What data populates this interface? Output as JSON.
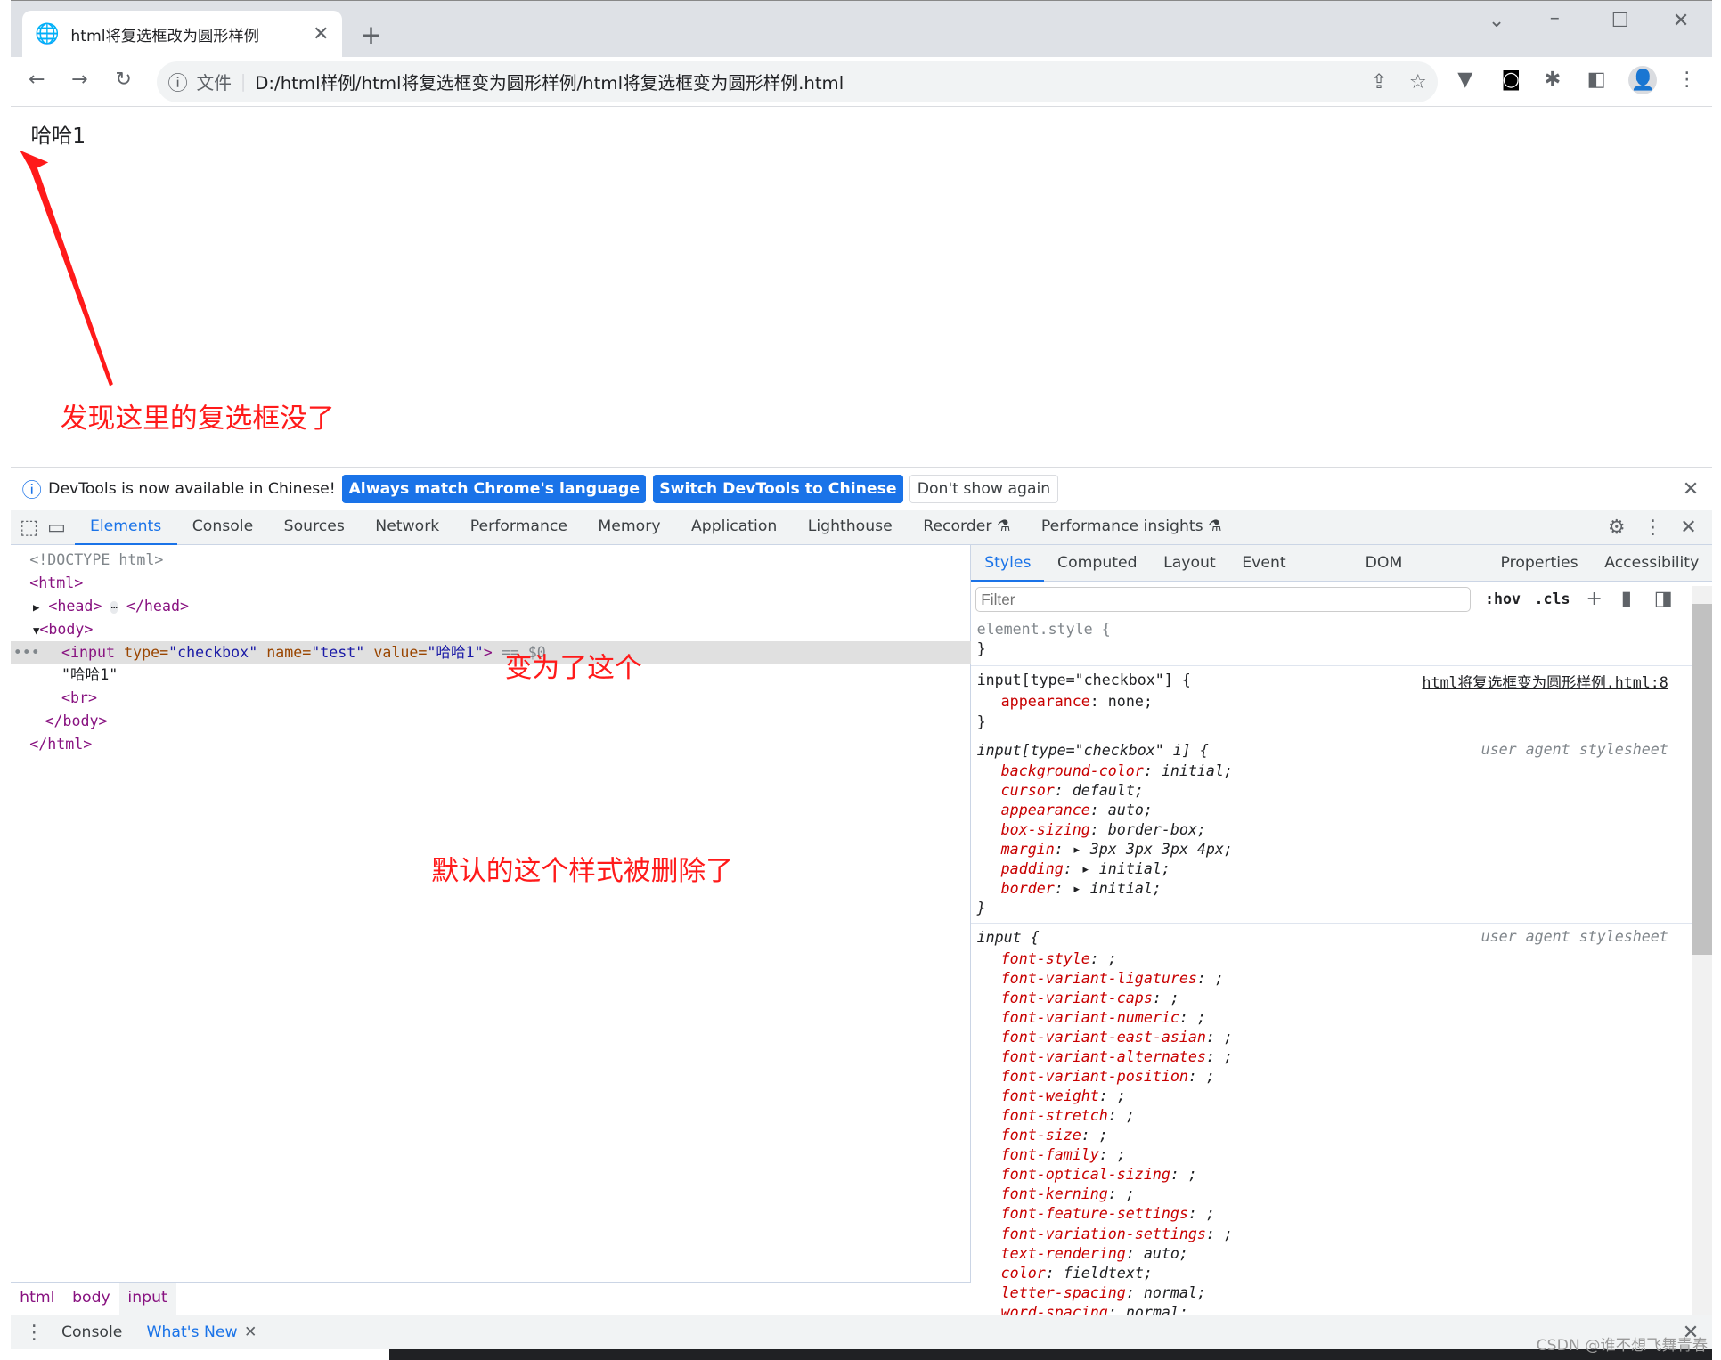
{
  "browser": {
    "tab_title": "html将复选框改为圆形样例",
    "address_prefix": "文件",
    "url": "D:/html样例/html将复选框变为圆形样例/html将复选框变为圆形样例.html"
  },
  "page": {
    "checkbox_label": "哈哈1"
  },
  "annotations": {
    "missing_checkbox": "发现这里的复选框没了",
    "became_this": "变为了这个",
    "default_removed": "默认的这个样式被删除了",
    "arrow_color": "#ff1a1a"
  },
  "infobar": {
    "message": "DevTools is now available in Chinese!",
    "btn_match": "Always match Chrome's language",
    "btn_switch": "Switch DevTools to Chinese",
    "btn_dont": "Don't show again"
  },
  "devtools": {
    "tabs": [
      "Elements",
      "Console",
      "Sources",
      "Network",
      "Performance",
      "Memory",
      "Application",
      "Lighthouse",
      "Recorder",
      "Performance insights"
    ],
    "dom": {
      "doctype": "<!DOCTYPE html>",
      "html_open": "<html>",
      "head": "<head>",
      "head_close": "</head>",
      "body_open": "<body>",
      "input_tag": "<input",
      "type_attr": "type=",
      "type_val": "\"checkbox\"",
      "name_attr": "name=",
      "name_val": "\"test\"",
      "value_attr": "value=",
      "value_val": "\"哈哈1\"",
      "input_end": ">",
      "eq": "== $0",
      "text_node": "\"哈哈1\"",
      "br": "<br>",
      "body_close": "</body>",
      "html_close": "</html>"
    },
    "styles_tabs": [
      "Styles",
      "Computed",
      "Layout",
      "Event Listeners",
      "DOM Breakpoints",
      "Properties",
      "Accessibility"
    ],
    "filter_placeholder": "Filter",
    "hov": ":hov",
    "cls": ".cls",
    "rules": {
      "element_style": "element.style {",
      "rule1_selector": "input[type=\"checkbox\"] {",
      "rule1_source": "html将复选框变为圆形样例.html:8",
      "rule1_prop": "appearance",
      "rule1_val": "none;",
      "rule2_selector": "input[type=\"checkbox\" i] {",
      "ua": "user agent stylesheet",
      "rule2_props": [
        [
          "background-color",
          "initial;"
        ],
        [
          "cursor",
          "default;"
        ],
        [
          "appearance",
          "auto;"
        ],
        [
          "box-sizing",
          "border-box;"
        ],
        [
          "margin",
          "▸ 3px 3px 3px 4px;"
        ],
        [
          "padding",
          "▸ initial;"
        ],
        [
          "border",
          "▸ initial;"
        ]
      ],
      "rule3_selector": "input {",
      "rule3_props": [
        [
          "font-style",
          ";"
        ],
        [
          "font-variant-ligatures",
          ";"
        ],
        [
          "font-variant-caps",
          ";"
        ],
        [
          "font-variant-numeric",
          ";"
        ],
        [
          "font-variant-east-asian",
          ";"
        ],
        [
          "font-variant-alternates",
          ";"
        ],
        [
          "font-variant-position",
          ";"
        ],
        [
          "font-weight",
          ";"
        ],
        [
          "font-stretch",
          ";"
        ],
        [
          "font-size",
          ";"
        ],
        [
          "font-family",
          ";"
        ],
        [
          "font-optical-sizing",
          ";"
        ],
        [
          "font-kerning",
          ";"
        ],
        [
          "font-feature-settings",
          ";"
        ],
        [
          "font-variation-settings",
          ";"
        ],
        [
          "text-rendering",
          "auto;"
        ],
        [
          "color",
          "fieldtext;"
        ],
        [
          "letter-spacing",
          "normal;"
        ],
        [
          "word-spacing",
          "normal;"
        ]
      ]
    },
    "breadcrumbs": [
      "html",
      "body",
      "input"
    ],
    "drawer": {
      "console": "Console",
      "whats_new": "What's New"
    }
  },
  "watermark": "CSDN @谁不想飞舞青春"
}
